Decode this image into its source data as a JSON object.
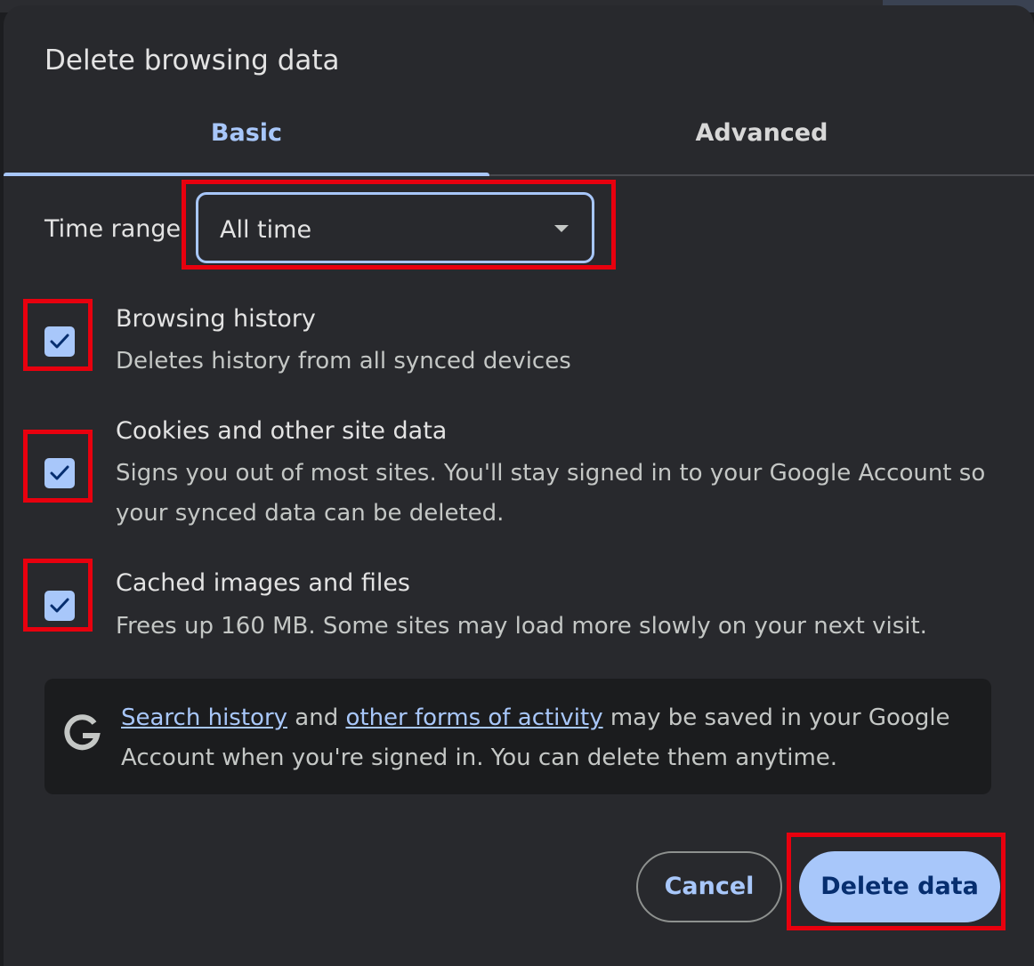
{
  "dialog": {
    "title": "Delete browsing data"
  },
  "tabs": [
    {
      "label": "Basic",
      "active": true
    },
    {
      "label": "Advanced",
      "active": false
    }
  ],
  "time_range": {
    "label": "Time range",
    "value": "All time"
  },
  "options": [
    {
      "title": "Browsing history",
      "description": "Deletes history from all synced devices",
      "checked": true
    },
    {
      "title": "Cookies and other site data",
      "description": "Signs you out of most sites. You'll stay signed in to your Google Account so your synced data can be deleted.",
      "checked": true
    },
    {
      "title": "Cached images and files",
      "description": "Frees up 160 MB. Some sites may load more slowly on your next visit.",
      "checked": true
    }
  ],
  "info": {
    "icon": "google-g-icon",
    "link1": "Search history",
    "and": "and",
    "link2": "other forms of activity",
    "text": "may be saved in your Google Account when you're signed in. You can delete them anytime."
  },
  "buttons": {
    "cancel": "Cancel",
    "delete": "Delete data"
  },
  "colors": {
    "accent": "#a8c7fa",
    "highlight": "#e8000e",
    "dialog_bg": "#28292d"
  }
}
